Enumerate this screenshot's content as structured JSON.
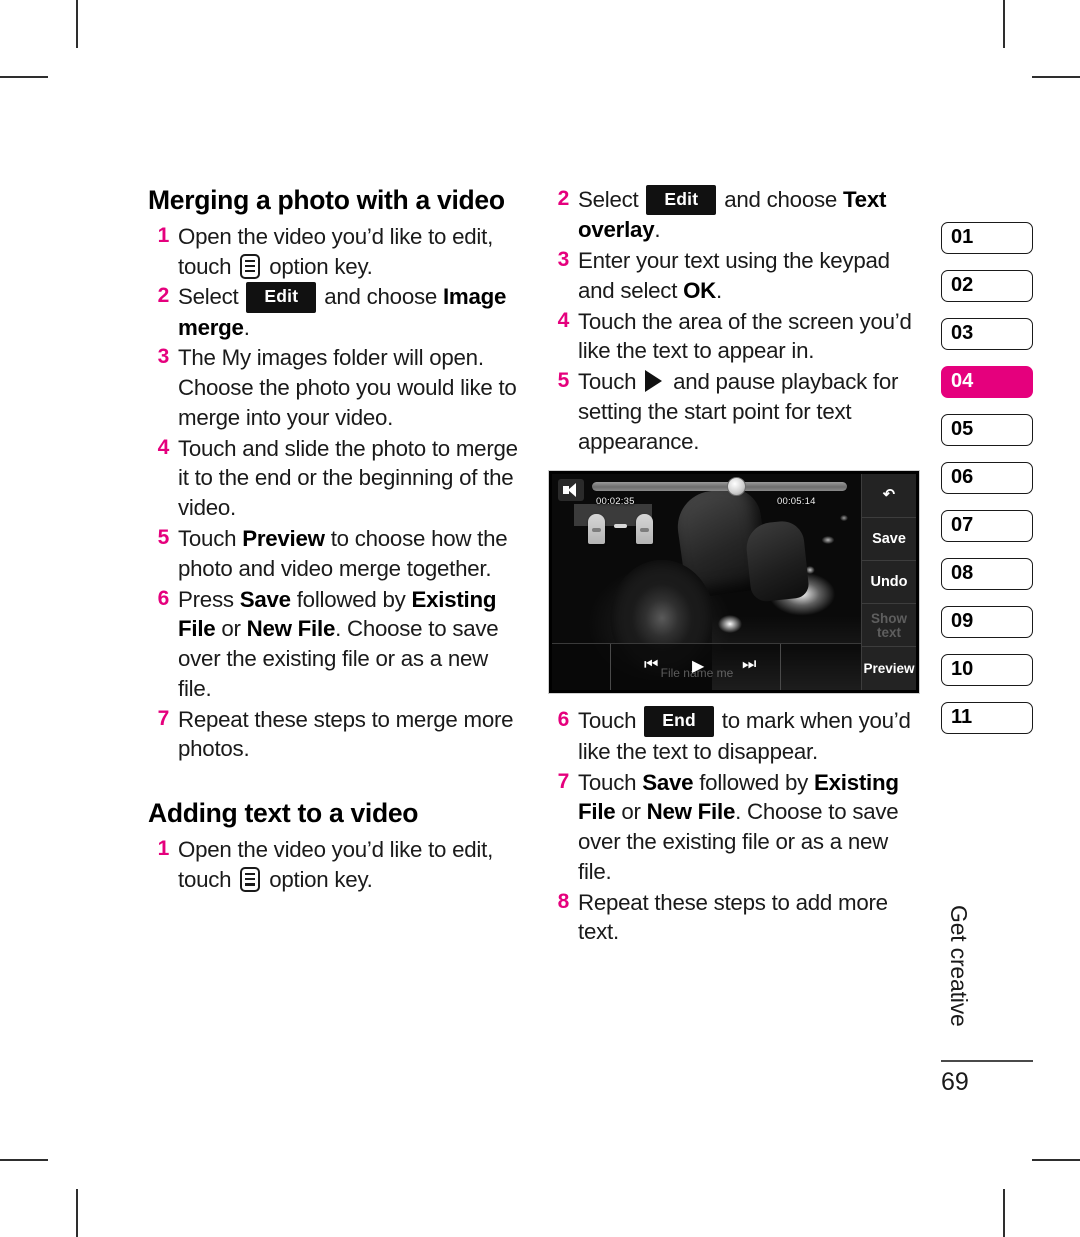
{
  "page": {
    "folio": "69",
    "running_head": "Get creative"
  },
  "tabs": {
    "active_index": 3,
    "items": [
      "01",
      "02",
      "03",
      "04",
      "05",
      "06",
      "07",
      "08",
      "09",
      "10",
      "11"
    ]
  },
  "colors": {
    "accent_magenta": "#e5007d",
    "text": "#1a1a1a",
    "keycap_bg": "#111111"
  },
  "left_column": {
    "section_title": "Merging a photo with a video",
    "steps": [
      {
        "num": "1",
        "parts": [
          {
            "type": "text",
            "value": "Open the video you’d like to edit, touch "
          },
          {
            "type": "icon",
            "value": "option-key-icon"
          },
          {
            "type": "text",
            "value": " option key."
          }
        ]
      },
      {
        "num": "2",
        "parts": [
          {
            "type": "text",
            "value": "Select "
          },
          {
            "type": "keycap",
            "value": "Edit"
          },
          {
            "type": "text",
            "value": " and choose "
          },
          {
            "type": "bold",
            "value": "Image merge"
          },
          {
            "type": "text",
            "value": "."
          }
        ]
      },
      {
        "num": "3",
        "parts": [
          {
            "type": "text",
            "value": "The My images folder will open. Choose the photo you would like to merge into your video."
          }
        ]
      },
      {
        "num": "4",
        "parts": [
          {
            "type": "text",
            "value": "Touch and slide the photo to merge it to the end or the beginning of the video."
          }
        ]
      },
      {
        "num": "5",
        "parts": [
          {
            "type": "text",
            "value": "Touch "
          },
          {
            "type": "bold",
            "value": "Preview"
          },
          {
            "type": "text",
            "value": " to choose how the photo and video merge together."
          }
        ]
      },
      {
        "num": "6",
        "parts": [
          {
            "type": "text",
            "value": "Press "
          },
          {
            "type": "bold",
            "value": "Save"
          },
          {
            "type": "text",
            "value": " followed by "
          },
          {
            "type": "bold",
            "value": "Existing File"
          },
          {
            "type": "text",
            "value": " or "
          },
          {
            "type": "bold",
            "value": "New File"
          },
          {
            "type": "text",
            "value": ". Choose to save over the existing file or as a new file."
          }
        ]
      },
      {
        "num": "7",
        "parts": [
          {
            "type": "text",
            "value": "Repeat these steps to merge more photos."
          }
        ]
      }
    ],
    "section_title_2": "Adding text to a video",
    "steps_2": [
      {
        "num": "1",
        "parts": [
          {
            "type": "text",
            "value": "Open the video you’d like to edit, touch "
          },
          {
            "type": "icon",
            "value": "option-key-icon"
          },
          {
            "type": "text",
            "value": " option key."
          }
        ]
      }
    ]
  },
  "right_column": {
    "steps_top": [
      {
        "num": "2",
        "parts": [
          {
            "type": "text",
            "value": "Select "
          },
          {
            "type": "keycap",
            "value": "Edit"
          },
          {
            "type": "text",
            "value": " and choose "
          },
          {
            "type": "bold",
            "value": "Text overlay"
          },
          {
            "type": "text",
            "value": "."
          }
        ]
      },
      {
        "num": "3",
        "parts": [
          {
            "type": "text",
            "value": "Enter your text using the keypad and select "
          },
          {
            "type": "bold",
            "value": "OK"
          },
          {
            "type": "text",
            "value": "."
          }
        ]
      },
      {
        "num": "4",
        "parts": [
          {
            "type": "text",
            "value": "Touch the area of the screen you’d like the text to appear in."
          }
        ]
      },
      {
        "num": "5",
        "parts": [
          {
            "type": "text",
            "value": "Touch "
          },
          {
            "type": "icon",
            "value": "play-triangle-icon"
          },
          {
            "type": "text",
            "value": " and pause playback for setting the start point for text appearance."
          }
        ]
      }
    ],
    "steps_bottom": [
      {
        "num": "6",
        "parts": [
          {
            "type": "text",
            "value": "Touch "
          },
          {
            "type": "keycap",
            "value": "End"
          },
          {
            "type": "text",
            "value": " to mark when you’d like the text to disappear."
          }
        ]
      },
      {
        "num": "7",
        "parts": [
          {
            "type": "text",
            "value": "Touch "
          },
          {
            "type": "bold",
            "value": "Save"
          },
          {
            "type": "text",
            "value": " followed by "
          },
          {
            "type": "bold",
            "value": "Existing File"
          },
          {
            "type": "text",
            "value": " or "
          },
          {
            "type": "bold",
            "value": "New File"
          },
          {
            "type": "text",
            "value": ". Choose to save over the existing file or as a new file."
          }
        ]
      },
      {
        "num": "8",
        "parts": [
          {
            "type": "text",
            "value": "Repeat these steps to add more text."
          }
        ]
      }
    ]
  },
  "phone_screenshot": {
    "current_time": "00:02:35",
    "total_time": "00:05:14",
    "file_name_label": "File name me",
    "rail_buttons": [
      "Save",
      "Undo",
      "Show text",
      "Preview"
    ],
    "back_icon": "back-arrow-icon",
    "speaker_icon": "speaker-icon",
    "transport": {
      "prev": "⏮",
      "play": "▶",
      "next": "⏭"
    }
  }
}
